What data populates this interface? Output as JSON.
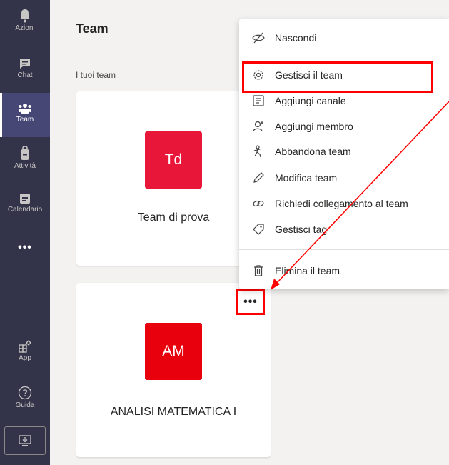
{
  "rail": {
    "items": [
      {
        "label": "Azioni",
        "icon": "bell-icon"
      },
      {
        "label": "Chat",
        "icon": "chat-icon"
      },
      {
        "label": "Team",
        "icon": "team-icon"
      },
      {
        "label": "Attività",
        "icon": "backpack-icon"
      },
      {
        "label": "Calendario",
        "icon": "calendar-icon"
      },
      {
        "label": "•••",
        "icon": "more-icon"
      },
      {
        "label": "App",
        "icon": "apps-icon"
      },
      {
        "label": "Guida",
        "icon": "help-icon"
      }
    ],
    "active": "Team",
    "download_icon": "download-icon"
  },
  "header": {
    "title": "Team"
  },
  "section_label": "I tuoi team",
  "teams": [
    {
      "initials": "Td",
      "name": "Team di prova",
      "color": "#e8173a"
    },
    {
      "initials": "AM",
      "name": "ANALISI MATEMATICA I",
      "color": "#e8000d"
    }
  ],
  "more_button": {
    "label": "•••"
  },
  "menu": {
    "items": [
      {
        "label": "Nascondi",
        "icon": "hide-eye-icon"
      },
      {
        "label": "Gestisci il team",
        "icon": "gear-icon"
      },
      {
        "label": "Aggiungi canale",
        "icon": "channel-icon"
      },
      {
        "label": "Aggiungi membro",
        "icon": "add-member-icon"
      },
      {
        "label": "Abbandona team",
        "icon": "leave-icon"
      },
      {
        "label": "Modifica team",
        "icon": "pencil-icon"
      },
      {
        "label": "Richiedi collegamento al team",
        "icon": "link-icon"
      },
      {
        "label": "Gestisci tag",
        "icon": "tag-icon"
      },
      {
        "label": "Elimina il team",
        "icon": "trash-icon"
      }
    ]
  },
  "colors": {
    "rail_bg": "#33344a",
    "accent": "#464775",
    "highlight": "#ff0000"
  }
}
